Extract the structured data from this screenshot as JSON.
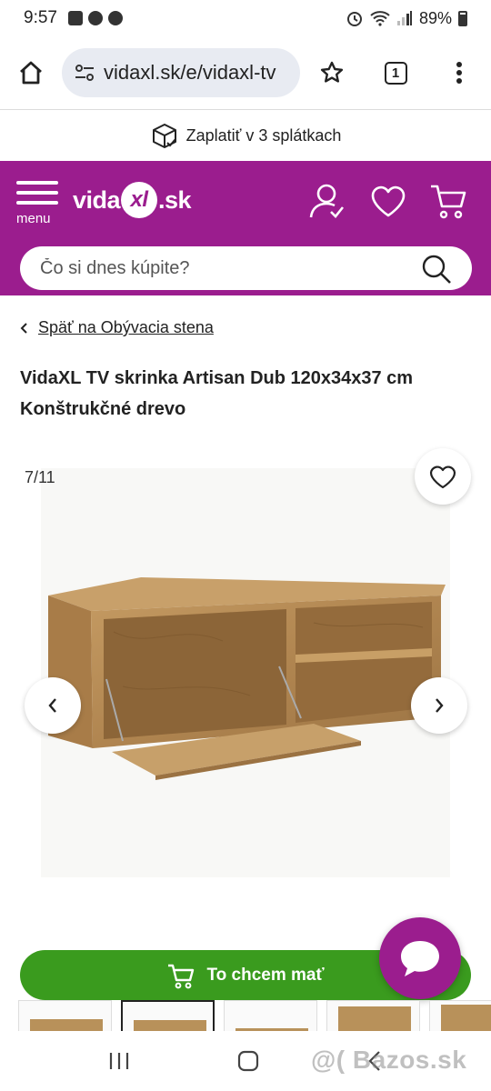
{
  "status_bar": {
    "time": "9:57",
    "battery": "89%"
  },
  "browser": {
    "url": "vidaxl.sk/e/vidaxl-tv",
    "tab_count": "1"
  },
  "promo": {
    "text": "Zaplatiť v 3 splátkach"
  },
  "header": {
    "menu_label": "menu",
    "logo_left": "vida",
    "logo_mid": "xl",
    "logo_right": ".sk",
    "search_placeholder": "Čo si dnes kúpite?",
    "brand_color": "#9b1d8e"
  },
  "breadcrumb": {
    "back_label": "Späť na Obývacia stena"
  },
  "product": {
    "title": "VidaXL TV skrinka Artisan Dub 120x34x37 cm Konštrukčné drevo"
  },
  "gallery": {
    "counter": "7/11"
  },
  "buy": {
    "label": "To chcem mať",
    "color": "#3a9b1e"
  },
  "watermark": "@( Bazos.sk"
}
